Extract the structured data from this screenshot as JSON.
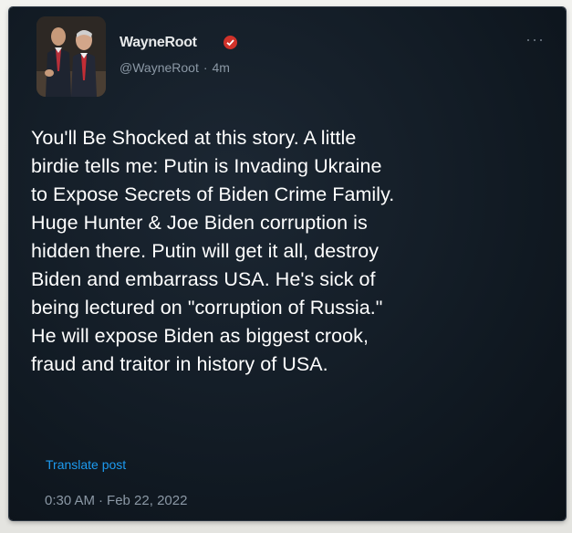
{
  "author": {
    "display_name": "WayneRoot",
    "handle": "@WayneRoot",
    "separator": "·",
    "time_ago": "4m"
  },
  "badge_color": "#d0322a",
  "more_icon": "more-icon",
  "post": {
    "lines": [
      "You'll Be Shocked at this story. A little",
      "birdie tells me: Putin is Invading Ukraine",
      "to Expose Secrets of Biden Crime Family.",
      "Huge Hunter & Joe Biden corruption is",
      "hidden there. Putin will get it all, destroy",
      "Biden and embarrass USA. He's sick of",
      "being lectured on \"corruption of Russia.\"",
      "He will expose Biden as biggest crook,",
      "fraud and traitor in history of USA."
    ],
    "translate_label": "Translate post",
    "time": "0:30 AM",
    "date_separator": "·",
    "date": "Feb 22, 2022"
  }
}
